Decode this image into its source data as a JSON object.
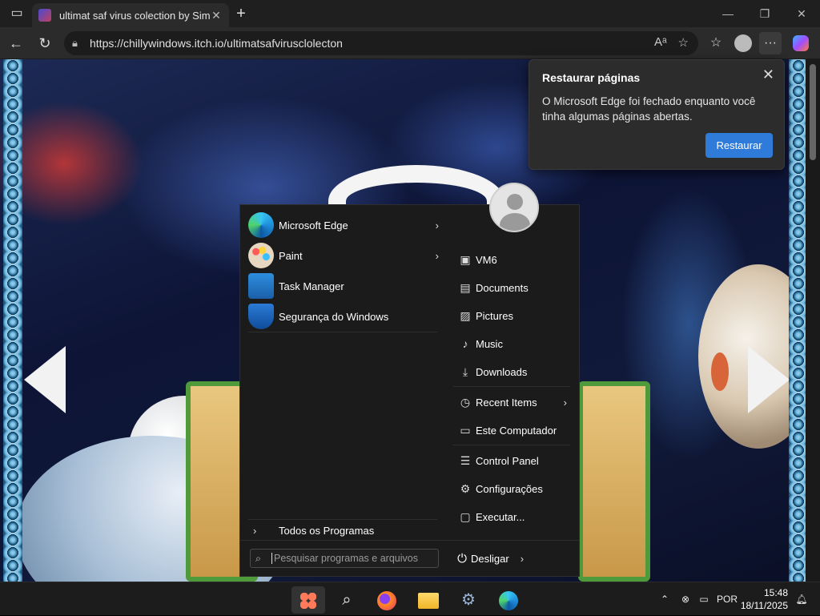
{
  "browser": {
    "tab_title": "ultimat saf virus colection by Sim...",
    "tab_close": "✕",
    "new_tab": "+",
    "url": "https://chillywindows.itch.io/ultimatsafvirusclolecton",
    "read_aloud": "Aᵃ",
    "star": "☆",
    "favorites": "☆",
    "more": "···",
    "min": "—",
    "max": "❐",
    "close": "✕"
  },
  "restore_popup": {
    "title": "Restaurar páginas",
    "body": "O Microsoft Edge foi fechado enquanto você tinha algumas páginas abertas.",
    "button": "Restaurar",
    "close": "✕"
  },
  "start_menu": {
    "pinned": [
      {
        "label": "Microsoft Edge",
        "has_submenu": true
      },
      {
        "label": "Paint",
        "has_submenu": true
      },
      {
        "label": "Task Manager",
        "has_submenu": false
      },
      {
        "label": "Segurança do Windows",
        "has_submenu": false
      }
    ],
    "all_programs": "Todos os Programas",
    "right": [
      {
        "label": "VM6",
        "icon": "folder-icon"
      },
      {
        "label": "Documents",
        "icon": "document-icon"
      },
      {
        "label": "Pictures",
        "icon": "picture-icon"
      },
      {
        "label": "Music",
        "icon": "music-icon"
      },
      {
        "label": "Downloads",
        "icon": "download-icon"
      },
      {
        "label": "Recent Items",
        "icon": "clock-icon"
      },
      {
        "label": "Este Computador",
        "icon": "computer-icon"
      },
      {
        "label": "Control Panel",
        "icon": "control-panel-icon"
      },
      {
        "label": "Configurações",
        "icon": "gear-icon"
      },
      {
        "label": "Executar...",
        "icon": "run-icon"
      }
    ],
    "search_placeholder": "Pesquisar programas e arquivos",
    "shutdown": "Desligar"
  },
  "taskbar": {
    "language": "POR",
    "time": "15:48",
    "date": "18/11/2025"
  }
}
